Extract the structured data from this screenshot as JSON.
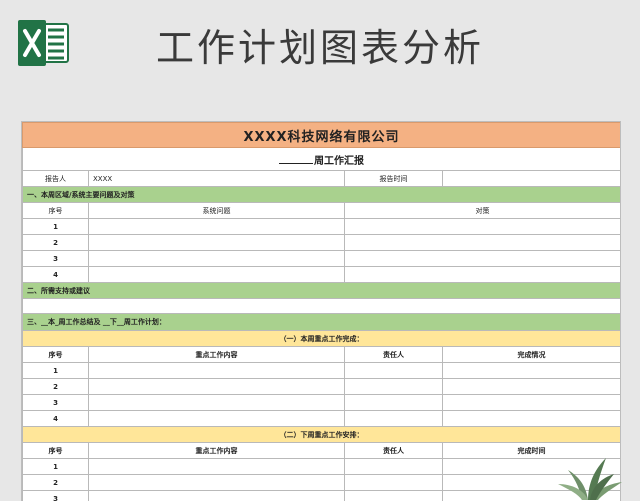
{
  "page_title": "工作计划图表分析",
  "icon": "excel-icon",
  "colors": {
    "title_bar": "#f4b183",
    "section_bar": "#a9d18e",
    "sub_bar": "#ffe699",
    "excel_green": "#217346"
  },
  "sheet": {
    "company": "XXXX科技网络有限公司",
    "report_title": "周工作汇报",
    "meta": {
      "reporter_label": "报告人",
      "reporter_value": "XXXX",
      "time_label": "报告时间",
      "time_value": ""
    },
    "section1": {
      "title": "一、本周区域/系统主要问题及对策",
      "headers": [
        "序号",
        "系统问题",
        "对策"
      ],
      "rows": [
        "1",
        "2",
        "3",
        "4"
      ]
    },
    "section2": {
      "title": "二、所需支持或建议"
    },
    "section3": {
      "title": "三、__本_周工作总结及 __下__周工作计划：",
      "sub1": {
        "title": "（一）本周重点工作完成：",
        "headers": [
          "序号",
          "重点工作内容",
          "责任人",
          "完成情况"
        ],
        "rows": [
          "1",
          "2",
          "3",
          "4"
        ]
      },
      "sub2": {
        "title": "（二）下周重点工作安排：",
        "headers": [
          "序号",
          "重点工作内容",
          "责任人",
          "完成时间"
        ],
        "rows": [
          "1",
          "2",
          "3"
        ]
      }
    }
  }
}
